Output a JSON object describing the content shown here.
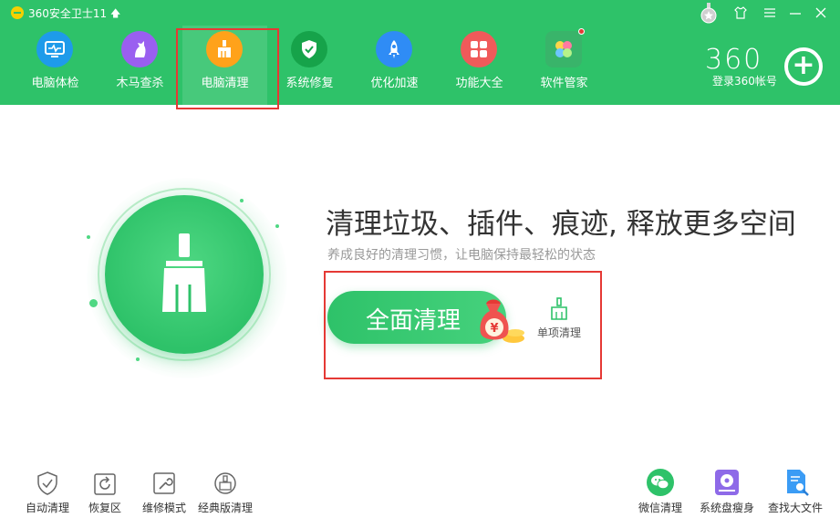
{
  "title_bar": {
    "title": "360安全卫士11",
    "upgrade_icon": "arrow-up-icon",
    "buttons": [
      "medal-icon",
      "skin-icon",
      "menu-icon",
      "minimize-icon",
      "close-icon"
    ]
  },
  "nav": {
    "active": "电脑清理",
    "items": [
      {
        "label": "电脑体检",
        "icon": "monitor-pulse-icon",
        "color": "#1e9bea"
      },
      {
        "label": "木马查杀",
        "icon": "horse-icon",
        "color": "#9a5ff0"
      },
      {
        "label": "电脑清理",
        "icon": "broom-icon",
        "color": "#ffa21a"
      },
      {
        "label": "系统修复",
        "icon": "shield-check-icon",
        "color": "#16a34a"
      },
      {
        "label": "优化加速",
        "icon": "rocket-icon",
        "color": "#2f8cf5"
      },
      {
        "label": "功能大全",
        "icon": "grid-icon",
        "color": "#f05a5a"
      },
      {
        "label": "软件管家",
        "icon": "software-store-icon",
        "color": "#39b46a"
      }
    ]
  },
  "account": {
    "brand": "360",
    "login": "登录360帐号",
    "action_icon": "plus-icon"
  },
  "hero": {
    "headline": "清理垃圾、插件、痕迹, 释放更多空间",
    "subline": "养成良好的清理习惯，让电脑保持最轻松的状态",
    "primary_button": "全面清理",
    "badge_icon": "money-bag-icon",
    "secondary": {
      "label": "单项清理",
      "icon": "small-broom-icon"
    }
  },
  "bottom_left": [
    {
      "label": "自动清理",
      "icon": "shield-check-outline-icon"
    },
    {
      "label": "恢复区",
      "icon": "restore-icon"
    },
    {
      "label": "维修模式",
      "icon": "wrench-icon"
    },
    {
      "label": "经典版清理",
      "icon": "classic-clean-icon"
    }
  ],
  "bottom_right": [
    {
      "label": "微信清理",
      "icon": "wechat-icon"
    },
    {
      "label": "系统盘瘦身",
      "icon": "disk-icon"
    },
    {
      "label": "查找大文件",
      "icon": "find-file-icon"
    }
  ],
  "colors": {
    "brand_green": "#2ec269",
    "highlight_red": "#e53935"
  }
}
